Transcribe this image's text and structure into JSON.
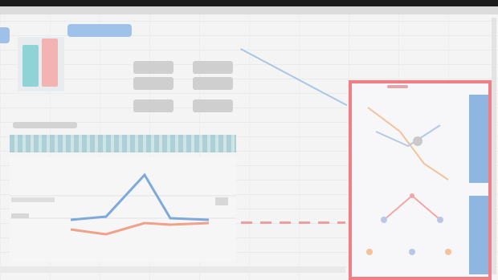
{
  "window": {
    "title": "",
    "accent": "#9ec2ea",
    "highlight": "#ef7f86"
  },
  "icons": {
    "left_tab": "tab-handle",
    "panel": "diagram-preview"
  },
  "colors": {
    "blue_series": "#8fb6e0",
    "orange_series": "#f0a18a",
    "teal_band": "#86bcc6",
    "sidebar_blue": "#8fb6e0"
  }
}
